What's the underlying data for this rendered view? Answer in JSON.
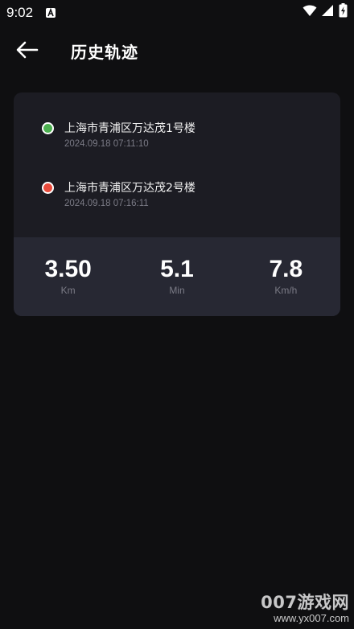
{
  "status_bar": {
    "time": "9:02",
    "notification_icon": "a-badge-icon",
    "wifi_icon": "wifi-icon",
    "signal_icon": "signal-icon",
    "battery_icon": "battery-charging-icon"
  },
  "header": {
    "back_icon": "arrow-left-icon",
    "title": "历史轨迹"
  },
  "route": {
    "start": {
      "address": "上海市青浦区万达茂1号楼",
      "time": "2024.09.18 07:11:10",
      "dot_color": "#4cb050"
    },
    "end": {
      "address": "上海市青浦区万达茂2号楼",
      "time": "2024.09.18 07:16:11",
      "dot_color": "#e94b3c"
    }
  },
  "stats": {
    "distance": {
      "value": "3.50",
      "unit": "Km"
    },
    "duration": {
      "value": "5.1",
      "unit": "Min"
    },
    "speed": {
      "value": "7.8",
      "unit": "Km/h"
    }
  },
  "watermark": {
    "main": "007游戏网",
    "sub": "www.yx007.com"
  },
  "colors": {
    "background": "#0f0f11",
    "card": "#1c1c23",
    "stats_panel": "#272833",
    "muted_text": "#7b7b86"
  }
}
